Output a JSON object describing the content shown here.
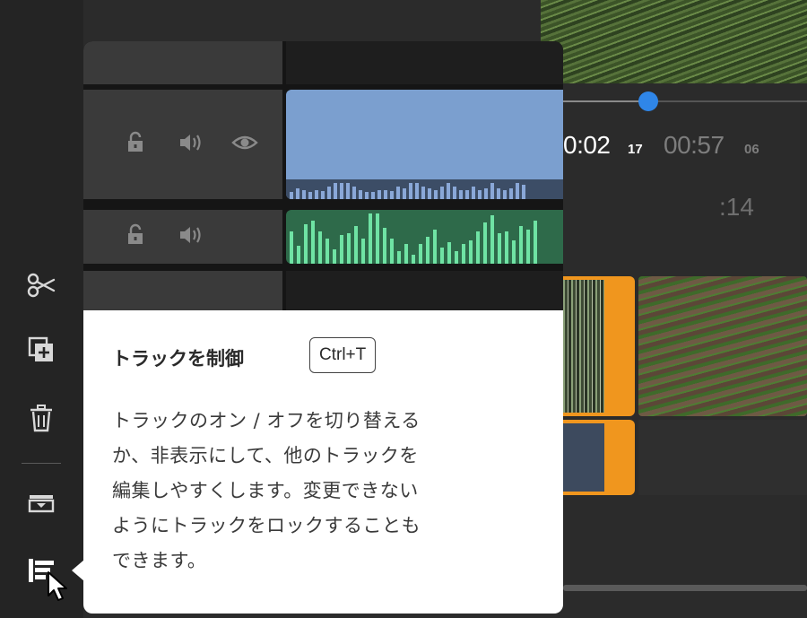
{
  "player": {
    "current_time": "0:02",
    "current_frames": "17",
    "total_time": "00:57",
    "total_frames": "06",
    "secondary_time": ":14",
    "scrubber_progress": 0.35
  },
  "toolbar": {
    "items": [
      {
        "name": "split",
        "icon": "scissors-icon"
      },
      {
        "name": "duplicate",
        "icon": "duplicate-add-icon"
      },
      {
        "name": "delete",
        "icon": "trash-icon"
      },
      {
        "name": "fit",
        "icon": "tray-down-icon"
      },
      {
        "name": "track-control",
        "icon": "track-control-icon",
        "active": true
      }
    ]
  },
  "tracks": [
    {
      "type": "video",
      "controls": [
        "lock-icon",
        "speaker-icon",
        "eye-icon"
      ]
    },
    {
      "type": "audio",
      "controls": [
        "lock-icon",
        "speaker-icon"
      ]
    },
    {
      "type": "empty",
      "controls": []
    }
  ],
  "tooltip": {
    "title": "トラックを制御",
    "shortcut": "Ctrl+T",
    "body_lines": [
      "トラックのオン / オフを切り替える",
      "か、非表示にして、他のトラックを",
      "編集しやすくします。変更できない",
      "ようにトラックをロックすることも",
      "できます。"
    ]
  },
  "colors": {
    "accent": "#2f86e8",
    "clip_orange": "#f0961e",
    "video_clip": "#7b9fcf",
    "audio_clip": "#2e6a4a",
    "audio_wave": "#6fe3a4"
  }
}
